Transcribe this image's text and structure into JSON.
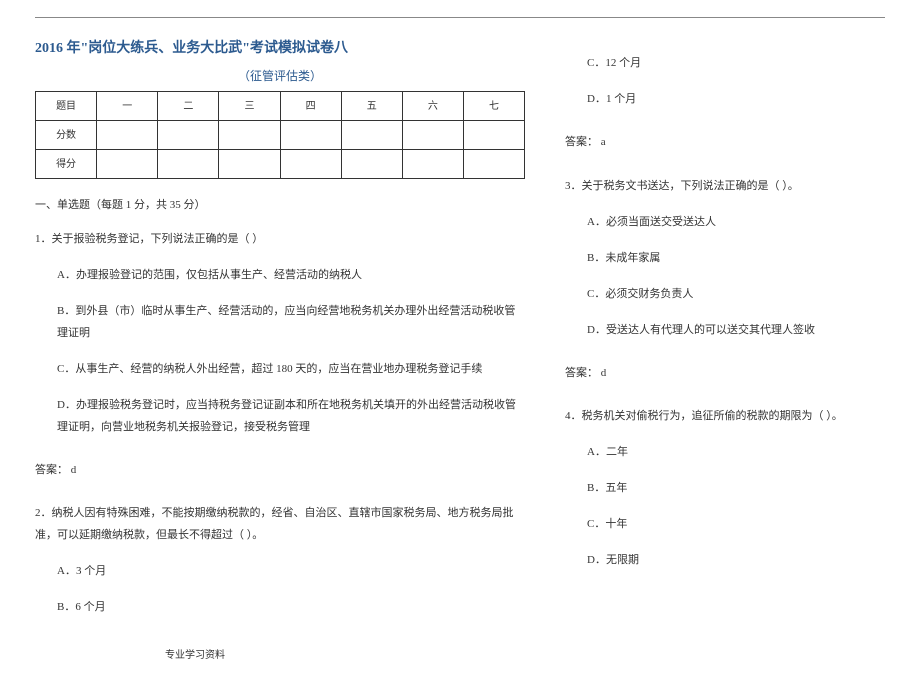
{
  "header_markers": [
    "",
    ""
  ],
  "title": "2016 年\"岗位大练兵、业务大比武\"考试模拟试卷八",
  "subtitle": "（征管评估类）",
  "table": {
    "row_labels": [
      "题目",
      "分数",
      "得分"
    ],
    "col_headers": [
      "一",
      "二",
      "三",
      "四",
      "五",
      "六",
      "七"
    ]
  },
  "section1_head": "一、单选题（每题 1 分，共 35 分）",
  "q1": {
    "stem": "1．关于报验税务登记，下列说法正确的是（    ）",
    "a": "A．办理报验登记的范围，仅包括从事生产、经营活动的纳税人",
    "b": "B．到外县（市）临时从事生产、经营活动的，应当向经营地税务机关办理外出经营活动税收管理证明",
    "c": "C．从事生产、经营的纳税人外出经营，超过 180 天的，应当在营业地办理税务登记手续",
    "d": "D．办理报验税务登记时，应当持税务登记证副本和所在地税务机关填开的外出经营活动税收管理证明，向营业地税务机关报验登记，接受税务管理",
    "answer": "答案： d"
  },
  "q2": {
    "stem": "2．纳税人因有特殊困难，不能按期缴纳税款的，经省、自治区、直辖市国家税务局、地方税务局批准，可以延期缴纳税款，但最长不得超过（    ）。",
    "a": "A．3 个月",
    "b": "B．6 个月",
    "c": "C．12 个月",
    "d": "D．1 个月",
    "answer": "答案： a"
  },
  "q3": {
    "stem": "3．关于税务文书送达，下列说法正确的是（    ）。",
    "a": "A．必须当面送交受送达人",
    "b": "B．未成年家属",
    "c": "C．必须交财务负责人",
    "d": "D．受送达人有代理人的可以送交其代理人签收",
    "answer": "答案： d"
  },
  "q4": {
    "stem": "4．税务机关对偷税行为，追征所偷的税款的期限为（    ）。",
    "a": "A．二年",
    "b": "B．五年",
    "c": "C．十年",
    "d": "D．无限期"
  },
  "footer": "专业学习资料"
}
